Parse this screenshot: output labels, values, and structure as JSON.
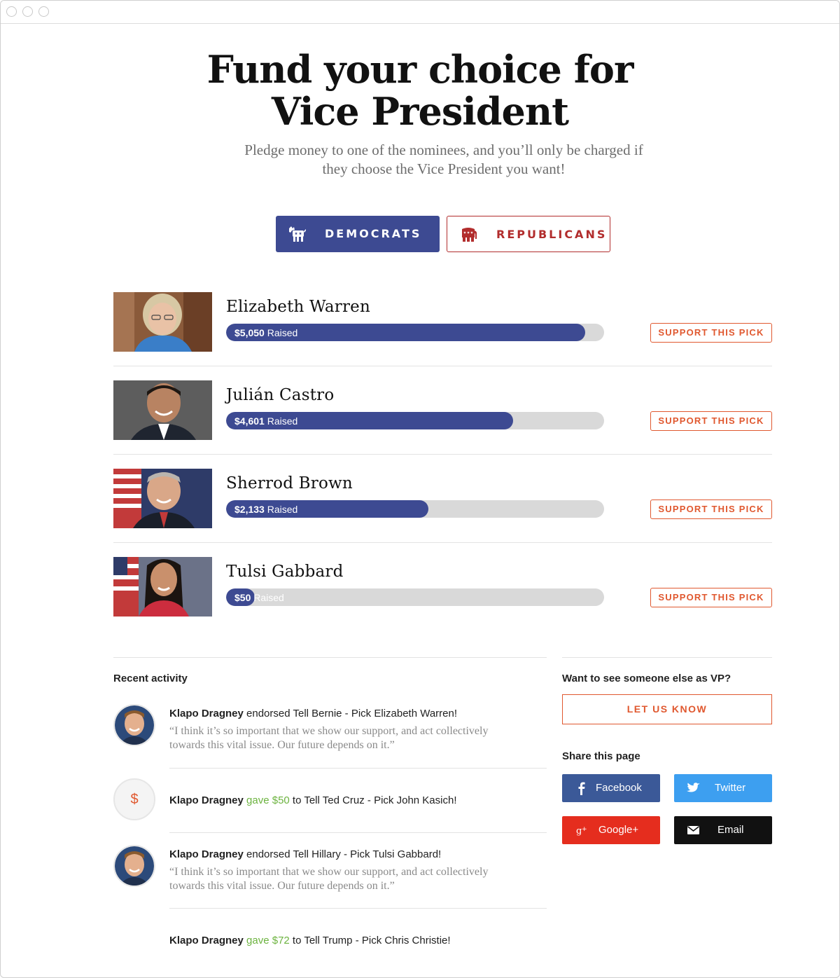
{
  "hero": {
    "title_line1": "Fund your choice for",
    "title_line2": "Vice President",
    "subtitle_line1": "Pledge money to one of the nominees, and you’ll only be charged if",
    "subtitle_line2": "they choose the Vice President you want!"
  },
  "party_tabs": {
    "democrats_label": "DEMOCRATS",
    "republicans_label": "REPUBLICANS",
    "democrats_icon": "donkey-icon",
    "republicans_icon": "elephant-icon",
    "selected": "democrats"
  },
  "colors": {
    "democrat_blue": "#3d4a92",
    "republican_red": "#b22d2d",
    "accent_orange": "#e0582f",
    "gave_green": "#6cb33f",
    "facebook": "#3b5998",
    "twitter": "#3d9ff0",
    "googleplus": "#e52d1e",
    "email": "#111111"
  },
  "candidates": [
    {
      "name": "Elizabeth Warren",
      "raised": "$5,050",
      "raised_suffix": "Raised",
      "progress": 0.95,
      "support_label": "SUPPORT THIS PICK"
    },
    {
      "name": "Julián Castro",
      "raised": "$4,601",
      "raised_suffix": "Raised",
      "progress": 0.76,
      "support_label": "SUPPORT THIS PICK"
    },
    {
      "name": "Sherrod Brown",
      "raised": "$2,133",
      "raised_suffix": "Raised",
      "progress": 0.535,
      "support_label": "SUPPORT THIS PICK"
    },
    {
      "name": "Tulsi Gabbard",
      "raised": "$50",
      "raised_suffix": "Raised",
      "progress": 0.075,
      "support_label": "SUPPORT THIS PICK"
    }
  ],
  "activity": {
    "heading": "Recent activity",
    "items": [
      {
        "who": "Klapo Dragney",
        "action": " endorsed ",
        "target": "Tell Bernie - Pick Elizabeth Warren!",
        "quote_line1": "“I think it’s so important that we show our support, and act collectively",
        "quote_line2": "towards this vital issue. Our future depends on it.”"
      },
      {
        "who": "Klapo Dragney",
        "action": " gave ",
        "amount": "$50",
        "target": " to Tell Ted Cruz - Pick John Kasich!",
        "icon": "$"
      },
      {
        "who": "Klapo Dragney",
        "action": " endorsed ",
        "target": "Tell Hillary - Pick Tulsi Gabbard!",
        "quote_line1": "“I think it’s so important that we show our support, and act collectively",
        "quote_line2": "towards this vital issue. Our future depends on it.”"
      },
      {
        "who": "Klapo Dragney",
        "action": " gave ",
        "amount": "$72",
        "target": " to Tell Trump - Pick Chris Christie!"
      }
    ]
  },
  "sidebar": {
    "vp_heading": "Want to see someone else as VP?",
    "let_us_know": "LET US KNOW",
    "share_heading": "Share this page",
    "share_buttons": [
      {
        "label": "Facebook",
        "icon": "facebook-icon"
      },
      {
        "label": "Twitter",
        "icon": "twitter-icon"
      },
      {
        "label": "Google+",
        "icon": "google-plus-icon"
      },
      {
        "label": "Email",
        "icon": "envelope-icon"
      }
    ]
  }
}
